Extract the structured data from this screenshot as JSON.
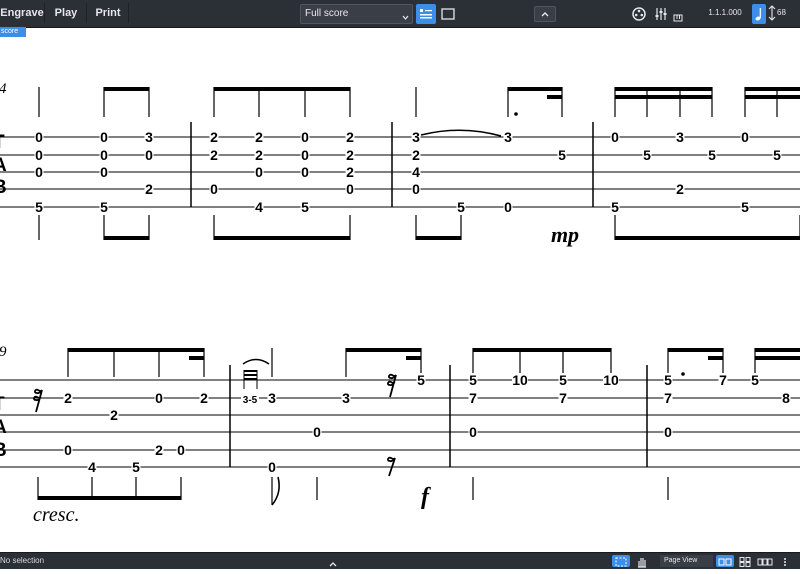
{
  "toolbar": {
    "modes": [
      "Engrave",
      "Play",
      "Print"
    ],
    "layout_select": "Full score",
    "position_readout": "1.1.1.000",
    "tempo": "68"
  },
  "tab_label": "score",
  "status": {
    "selection": "No selection",
    "view_mode": "Page View"
  },
  "colors": {
    "chrome": "#2b2f36",
    "accent": "#3d8ee8",
    "ink": "#000000"
  },
  "score": {
    "system1": {
      "bar_number": "4",
      "dynamic": "mp",
      "bars": [
        {
          "notes": [
            [
              "0",
              "0",
              "0",
              null,
              "5"
            ],
            [
              "0",
              "0",
              "0",
              null,
              "5"
            ],
            [
              "3",
              "0",
              null,
              "2",
              null
            ]
          ]
        },
        {
          "notes": [
            [
              "2",
              "2",
              null,
              "0",
              null
            ],
            [
              "2",
              "2",
              "0",
              null,
              "4"
            ],
            [
              "0",
              "0",
              "0",
              null,
              "5"
            ],
            [
              "2",
              "2",
              "2",
              "0",
              null
            ]
          ]
        },
        {
          "notes": [
            [
              "3",
              "2",
              "4",
              "0",
              null
            ],
            [
              "5"
            ],
            [
              "3",
              "0"
            ],
            [
              "5"
            ]
          ]
        },
        {
          "notes": [
            [
              "0",
              null,
              "5"
            ],
            [
              "5"
            ],
            [
              "3",
              "2"
            ],
            [
              "5"
            ],
            [
              "0",
              "5"
            ],
            [
              "5"
            ]
          ]
        }
      ]
    },
    "system2": {
      "bar_number": "9",
      "dynamic": "f",
      "expression": "cresc.",
      "bars": [
        {
          "notes": [
            [
              "2",
              "0"
            ],
            [
              "4"
            ],
            [
              "2"
            ],
            [
              "5"
            ],
            [
              "0",
              "2"
            ],
            [
              "0"
            ],
            [
              "2"
            ]
          ]
        },
        {
          "notes": [
            [
              "3-5"
            ],
            [
              "3",
              "0"
            ],
            [
              "3"
            ],
            [
              "0"
            ],
            [
              "3"
            ],
            [
              "5"
            ]
          ]
        },
        {
          "notes": [
            [
              "5",
              "7",
              "0"
            ],
            [
              "10"
            ],
            [
              "5",
              "7"
            ],
            [
              "10"
            ]
          ]
        },
        {
          "notes": [
            [
              "5",
              "7",
              "0"
            ],
            [
              "7"
            ],
            [
              "5"
            ],
            [
              "8"
            ]
          ]
        }
      ]
    }
  }
}
